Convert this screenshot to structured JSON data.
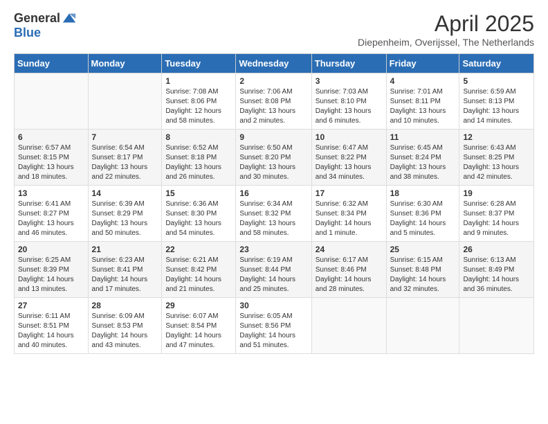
{
  "header": {
    "logo_general": "General",
    "logo_blue": "Blue",
    "month_title": "April 2025",
    "location": "Diepenheim, Overijssel, The Netherlands"
  },
  "days_of_week": [
    "Sunday",
    "Monday",
    "Tuesday",
    "Wednesday",
    "Thursday",
    "Friday",
    "Saturday"
  ],
  "weeks": [
    [
      {
        "day": "",
        "info": ""
      },
      {
        "day": "",
        "info": ""
      },
      {
        "day": "1",
        "info": "Sunrise: 7:08 AM\nSunset: 8:06 PM\nDaylight: 12 hours\nand 58 minutes."
      },
      {
        "day": "2",
        "info": "Sunrise: 7:06 AM\nSunset: 8:08 PM\nDaylight: 13 hours\nand 2 minutes."
      },
      {
        "day": "3",
        "info": "Sunrise: 7:03 AM\nSunset: 8:10 PM\nDaylight: 13 hours\nand 6 minutes."
      },
      {
        "day": "4",
        "info": "Sunrise: 7:01 AM\nSunset: 8:11 PM\nDaylight: 13 hours\nand 10 minutes."
      },
      {
        "day": "5",
        "info": "Sunrise: 6:59 AM\nSunset: 8:13 PM\nDaylight: 13 hours\nand 14 minutes."
      }
    ],
    [
      {
        "day": "6",
        "info": "Sunrise: 6:57 AM\nSunset: 8:15 PM\nDaylight: 13 hours\nand 18 minutes."
      },
      {
        "day": "7",
        "info": "Sunrise: 6:54 AM\nSunset: 8:17 PM\nDaylight: 13 hours\nand 22 minutes."
      },
      {
        "day": "8",
        "info": "Sunrise: 6:52 AM\nSunset: 8:18 PM\nDaylight: 13 hours\nand 26 minutes."
      },
      {
        "day": "9",
        "info": "Sunrise: 6:50 AM\nSunset: 8:20 PM\nDaylight: 13 hours\nand 30 minutes."
      },
      {
        "day": "10",
        "info": "Sunrise: 6:47 AM\nSunset: 8:22 PM\nDaylight: 13 hours\nand 34 minutes."
      },
      {
        "day": "11",
        "info": "Sunrise: 6:45 AM\nSunset: 8:24 PM\nDaylight: 13 hours\nand 38 minutes."
      },
      {
        "day": "12",
        "info": "Sunrise: 6:43 AM\nSunset: 8:25 PM\nDaylight: 13 hours\nand 42 minutes."
      }
    ],
    [
      {
        "day": "13",
        "info": "Sunrise: 6:41 AM\nSunset: 8:27 PM\nDaylight: 13 hours\nand 46 minutes."
      },
      {
        "day": "14",
        "info": "Sunrise: 6:39 AM\nSunset: 8:29 PM\nDaylight: 13 hours\nand 50 minutes."
      },
      {
        "day": "15",
        "info": "Sunrise: 6:36 AM\nSunset: 8:30 PM\nDaylight: 13 hours\nand 54 minutes."
      },
      {
        "day": "16",
        "info": "Sunrise: 6:34 AM\nSunset: 8:32 PM\nDaylight: 13 hours\nand 58 minutes."
      },
      {
        "day": "17",
        "info": "Sunrise: 6:32 AM\nSunset: 8:34 PM\nDaylight: 14 hours\nand 1 minute."
      },
      {
        "day": "18",
        "info": "Sunrise: 6:30 AM\nSunset: 8:36 PM\nDaylight: 14 hours\nand 5 minutes."
      },
      {
        "day": "19",
        "info": "Sunrise: 6:28 AM\nSunset: 8:37 PM\nDaylight: 14 hours\nand 9 minutes."
      }
    ],
    [
      {
        "day": "20",
        "info": "Sunrise: 6:25 AM\nSunset: 8:39 PM\nDaylight: 14 hours\nand 13 minutes."
      },
      {
        "day": "21",
        "info": "Sunrise: 6:23 AM\nSunset: 8:41 PM\nDaylight: 14 hours\nand 17 minutes."
      },
      {
        "day": "22",
        "info": "Sunrise: 6:21 AM\nSunset: 8:42 PM\nDaylight: 14 hours\nand 21 minutes."
      },
      {
        "day": "23",
        "info": "Sunrise: 6:19 AM\nSunset: 8:44 PM\nDaylight: 14 hours\nand 25 minutes."
      },
      {
        "day": "24",
        "info": "Sunrise: 6:17 AM\nSunset: 8:46 PM\nDaylight: 14 hours\nand 28 minutes."
      },
      {
        "day": "25",
        "info": "Sunrise: 6:15 AM\nSunset: 8:48 PM\nDaylight: 14 hours\nand 32 minutes."
      },
      {
        "day": "26",
        "info": "Sunrise: 6:13 AM\nSunset: 8:49 PM\nDaylight: 14 hours\nand 36 minutes."
      }
    ],
    [
      {
        "day": "27",
        "info": "Sunrise: 6:11 AM\nSunset: 8:51 PM\nDaylight: 14 hours\nand 40 minutes."
      },
      {
        "day": "28",
        "info": "Sunrise: 6:09 AM\nSunset: 8:53 PM\nDaylight: 14 hours\nand 43 minutes."
      },
      {
        "day": "29",
        "info": "Sunrise: 6:07 AM\nSunset: 8:54 PM\nDaylight: 14 hours\nand 47 minutes."
      },
      {
        "day": "30",
        "info": "Sunrise: 6:05 AM\nSunset: 8:56 PM\nDaylight: 14 hours\nand 51 minutes."
      },
      {
        "day": "",
        "info": ""
      },
      {
        "day": "",
        "info": ""
      },
      {
        "day": "",
        "info": ""
      }
    ]
  ]
}
